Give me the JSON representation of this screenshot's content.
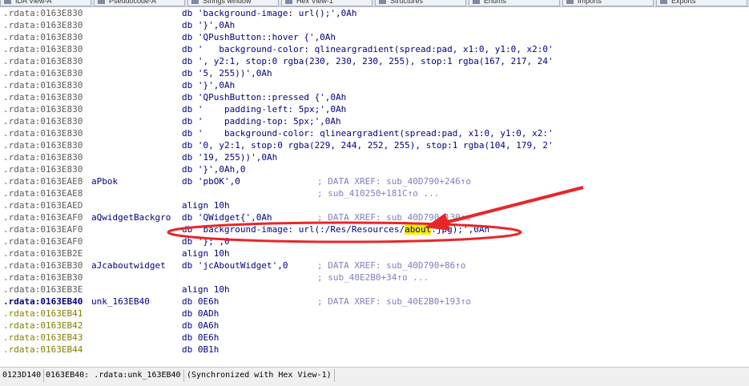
{
  "tabs": [
    {
      "label": "IDA View-A"
    },
    {
      "label": "Pseudocode-A"
    },
    {
      "label": "Strings window"
    },
    {
      "label": "Hex View-1"
    },
    {
      "label": "Structures"
    },
    {
      "label": "Enums"
    },
    {
      "label": "Imports"
    },
    {
      "label": "Exports"
    }
  ],
  "listing": [
    {
      "addr": ".rdata:0163E830",
      "label": "",
      "instr": "db 'background-image: url();',0Ah",
      "comment": ""
    },
    {
      "addr": ".rdata:0163E830",
      "label": "",
      "instr": "db '}',0Ah",
      "comment": ""
    },
    {
      "addr": ".rdata:0163E830",
      "label": "",
      "instr": "db 'QPushButton::hover {',0Ah",
      "comment": ""
    },
    {
      "addr": ".rdata:0163E830",
      "label": "",
      "instr": "db '   background-color: qlineargradient(spread:pad, x1:0, y1:0, x2:0'",
      "comment": ""
    },
    {
      "addr": ".rdata:0163E830",
      "label": "",
      "instr": "db ', y2:1, stop:0 rgba(230, 230, 230, 255), stop:1 rgba(167, 217, 24'",
      "comment": ""
    },
    {
      "addr": ".rdata:0163E830",
      "label": "",
      "instr": "db '5, 255))',0Ah",
      "comment": ""
    },
    {
      "addr": ".rdata:0163E830",
      "label": "",
      "instr": "db '}',0Ah",
      "comment": ""
    },
    {
      "addr": ".rdata:0163E830",
      "label": "",
      "instr": "db 'QPushButton::pressed {',0Ah",
      "comment": ""
    },
    {
      "addr": ".rdata:0163E830",
      "label": "",
      "instr": "db '    padding-left: 5px;',0Ah",
      "comment": ""
    },
    {
      "addr": ".rdata:0163E830",
      "label": "",
      "instr": "db '    padding-top: 5px;',0Ah",
      "comment": ""
    },
    {
      "addr": ".rdata:0163E830",
      "label": "",
      "instr": "db '    background-color: qlineargradient(spread:pad, x1:0, y1:0, x2:'",
      "comment": ""
    },
    {
      "addr": ".rdata:0163E830",
      "label": "",
      "instr": "db '0, y2:1, stop:0 rgba(229, 244, 252, 255), stop:1 rgba(104, 179, 2'",
      "comment": ""
    },
    {
      "addr": ".rdata:0163E830",
      "label": "",
      "instr": "db '19, 255))',0Ah",
      "comment": ""
    },
    {
      "addr": ".rdata:0163E830",
      "label": "",
      "instr": "db '}',0Ah,0",
      "comment": ""
    },
    {
      "addr": ".rdata:0163EAE8",
      "label": "aPbok",
      "instr": "db 'pbOK',0",
      "comment": "; DATA XREF: sub_40D790+246↑o"
    },
    {
      "addr": ".rdata:0163EAE8",
      "label": "",
      "instr": "",
      "comment": "; sub_410250+181C↑o ..."
    },
    {
      "addr": ".rdata:0163EAED",
      "label": "",
      "instr": "align 10h",
      "comment": ""
    },
    {
      "addr": ".rdata:0163EAF0",
      "label": "aQwidgetBackgro",
      "instr": "db 'QWidget{',0Ah",
      "comment": "; DATA XREF: sub_40D790+130↑o"
    },
    {
      "addr": ".rdata:0163EAF0",
      "label": "",
      "instr": "db 'background-image: url(:/Res/Resources/about.jpg);',0Ah",
      "comment": ""
    },
    {
      "addr": ".rdata:0163EAF0",
      "label": "",
      "instr": "db '};',0",
      "comment": ""
    },
    {
      "addr": ".rdata:0163EB2E",
      "label": "",
      "instr": "align 10h",
      "comment": ""
    },
    {
      "addr": ".rdata:0163EB30",
      "label": "aJcaboutwidget",
      "instr": "db 'jcAboutWidget',0",
      "comment": "; DATA XREF: sub_40D790+86↑o"
    },
    {
      "addr": ".rdata:0163EB30",
      "label": "",
      "instr": "",
      "comment": "; sub_40E2B0+34↑o ..."
    },
    {
      "addr": ".rdata:0163EB3E",
      "label": "",
      "instr": "align 10h",
      "comment": ""
    },
    {
      "addr": ".rdata:0163EB40",
      "label": "unk_163EB40",
      "instr": "db 0E6h",
      "comment": "; DATA XREF: sub_40E2B0+193↑o"
    },
    {
      "addr": ".rdata:0163EB41",
      "label": "",
      "instr": "db 0ADh",
      "comment": ""
    },
    {
      "addr": ".rdata:0163EB42",
      "label": "",
      "instr": "db 0A6h",
      "comment": ""
    },
    {
      "addr": ".rdata:0163EB43",
      "label": "",
      "instr": "db 0E6h",
      "comment": ""
    },
    {
      "addr": ".rdata:0163EB44",
      "label": "",
      "instr": "db 0B1h",
      "comment": ""
    }
  ],
  "highlight_word": "about",
  "status": {
    "offset": "0123D140",
    "location": "0163EB40: .rdata:unk_163EB40",
    "sync": "(Synchronized with Hex View-1)"
  },
  "colors": {
    "code_text": "#000080",
    "address_grey": "#5a5a5a",
    "address_olive": "#808000",
    "comment": "#7f7fbf",
    "search_highlight": "#f4f000",
    "annotation_red": "#e8262a"
  }
}
